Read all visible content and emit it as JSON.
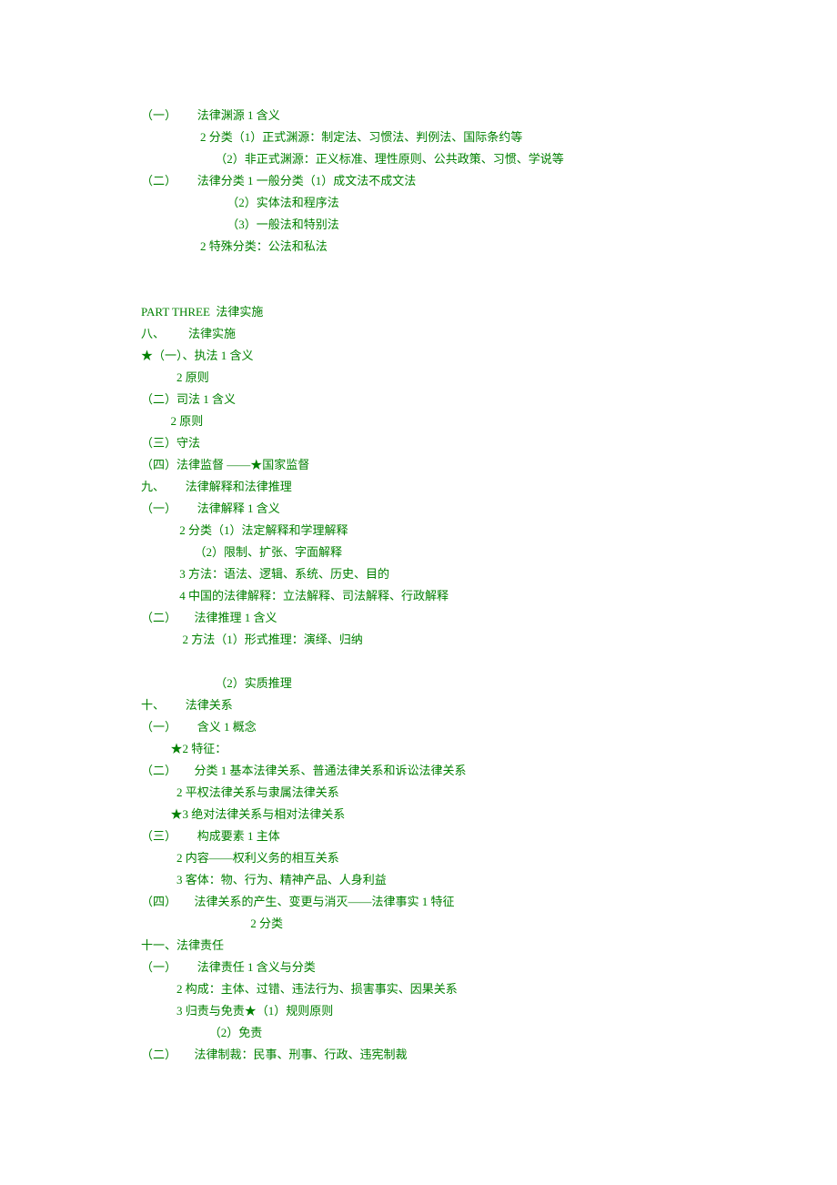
{
  "lines": {
    "l01": "（一）       法律渊源 1 含义",
    "l02": "                    2 分类（1）正式渊源：制定法、习惯法、判例法、国际条约等",
    "l03": "                         （2）非正式渊源：正义标准、理性原则、公共政策、习惯、学说等",
    "l04": "（二）       法律分类 1 一般分类（1）成文法不成文法",
    "l05": "                             （2）实体法和程序法",
    "l06": "                             （3）一般法和特别法",
    "l07": "                    2 特殊分类：公法和私法",
    "blank1": " ",
    "blank2": " ",
    "l08": "PART THREE  法律实施",
    "l09": "八、        法律实施",
    "l10": "★（一）、执法 1 含义",
    "l11": "            2 原则",
    "l12": "（二）司法 1 含义",
    "l13": "          2 原则",
    "l14": "（三）守法",
    "l15": "（四）法律监督 ——★国家监督",
    "l16": "九、       法律解释和法律推理",
    "l17": "（一）       法律解释 1 含义",
    "l18": "             2 分类（1）法定解释和学理解释",
    "l19": "                  （2）限制、扩张、字面解释",
    "l20": "             3 方法：语法、逻辑、系统、历史、目的",
    "l21": "             4 中国的法律解释：立法解释、司法解释、行政解释",
    "l22": "（二）      法律推理 1 含义",
    "l23": "              2 方法（1）形式推理：演绎、归纳",
    "blank3": " ",
    "l24": "                         （2）实质推理",
    "l25": "十、       法律关系",
    "l26": "（一）       含义 1 概念",
    "l27": "          ★2 特征：",
    "l28": "（二）      分类 1 基本法律关系、普通法律关系和诉讼法律关系",
    "l29": "            2 平权法律关系与隶属法律关系",
    "l30": "          ★3 绝对法律关系与相对法律关系",
    "l31": "（三）       构成要素 1 主体",
    "l32": "            2 内容——权利义务的相互关系",
    "l33": "            3 客体：物、行为、精神产品、人身利益",
    "l34": "（四）      法律关系的产生、变更与消灭——法律事实 1 特征",
    "l35": "                                     2 分类",
    "l36": "十一、法律责任",
    "l37": "（一）       法律责任 1 含义与分类",
    "l38": "            2 构成：主体、过错、违法行为、损害事实、因果关系",
    "l39": "            3 归责与免责★（1）规则原则",
    "l40": "                       （2）免责",
    "l41": "（二）      法律制裁：民事、刑事、行政、违宪制裁"
  }
}
